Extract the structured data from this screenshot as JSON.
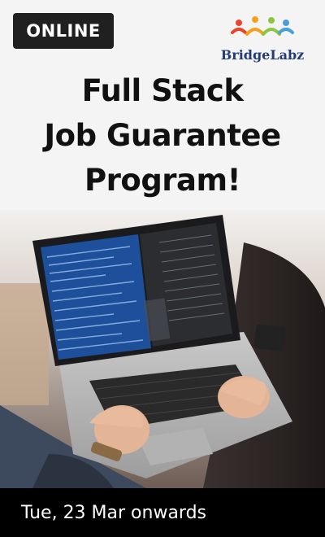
{
  "badge": {
    "label": "ONLINE"
  },
  "logo": {
    "name": "BridgeLabz",
    "icon": "people-group-icon",
    "colors": [
      "#e8452c",
      "#f4a21d",
      "#8cc63f",
      "#4a9fd8"
    ]
  },
  "headline": {
    "lines": [
      "Full Stack",
      "Job Guarantee",
      "Program!"
    ]
  },
  "photo": {
    "subject": "laptop-with-code-editor-image"
  },
  "footer": {
    "date_text": "Tue, 23 Mar onwards"
  }
}
